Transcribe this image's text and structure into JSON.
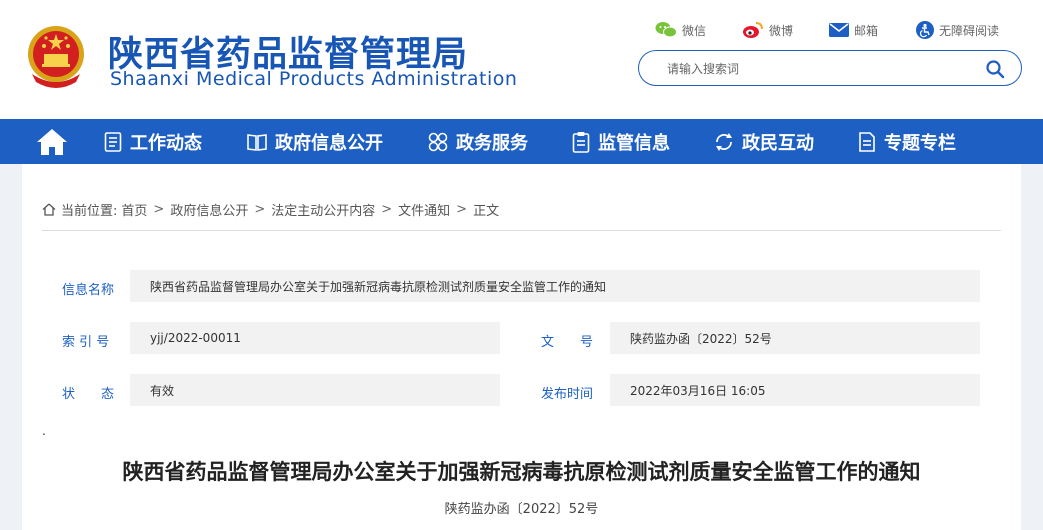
{
  "header": {
    "title_cn": "陕西省药品监督管理局",
    "title_en": "Shaanxi Medical Products Administration",
    "tools": [
      {
        "label": "微信",
        "icon": "wechat-icon"
      },
      {
        "label": "微博",
        "icon": "weibo-icon"
      },
      {
        "label": "邮箱",
        "icon": "mail-icon"
      },
      {
        "label": "无障碍阅读",
        "icon": "accessibility-icon"
      }
    ],
    "search": {
      "placeholder": "请输入搜索词",
      "icon": "search-icon"
    }
  },
  "nav": {
    "home_icon": "home-icon",
    "items": [
      {
        "label": "工作动态",
        "icon": "list-icon"
      },
      {
        "label": "政府信息公开",
        "icon": "book-icon"
      },
      {
        "label": "政务服务",
        "icon": "circles-icon"
      },
      {
        "label": "监管信息",
        "icon": "clipboard-icon"
      },
      {
        "label": "政民互动",
        "icon": "interaction-icon"
      },
      {
        "label": "专题专栏",
        "icon": "document-icon"
      }
    ]
  },
  "breadcrumb": {
    "prefix": "当前位置:",
    "items": [
      "首页",
      "政府信息公开",
      "法定主动公开内容",
      "文件通知",
      "正文"
    ],
    "separator": ">"
  },
  "meta": {
    "info_name_label": "信息名称",
    "info_name_value": "陕西省药品监督管理局办公室关于加强新冠病毒抗原检测试剂质量安全监管工作的通知",
    "index_label": "索 引 号",
    "index_value": "yjj/2022-00011",
    "docno_label": "文　　号",
    "docno_value": "陕药监办函〔2022〕52号",
    "status_label": "状　　态",
    "status_value": "有效",
    "date_label": "发布时间",
    "date_value": "2022年03月16日 16:05"
  },
  "document": {
    "dot": ".",
    "title": "陕西省药品监督管理局办公室关于加强新冠病毒抗原检测试剂质量安全监管工作的通知",
    "subtitle": "陕药监办函〔2022〕52号"
  },
  "colors": {
    "brand_blue": "#1d5fc3",
    "title_blue": "#1756b4",
    "meta_bg": "#f2f2f2",
    "page_bg": "#eef1f5"
  }
}
